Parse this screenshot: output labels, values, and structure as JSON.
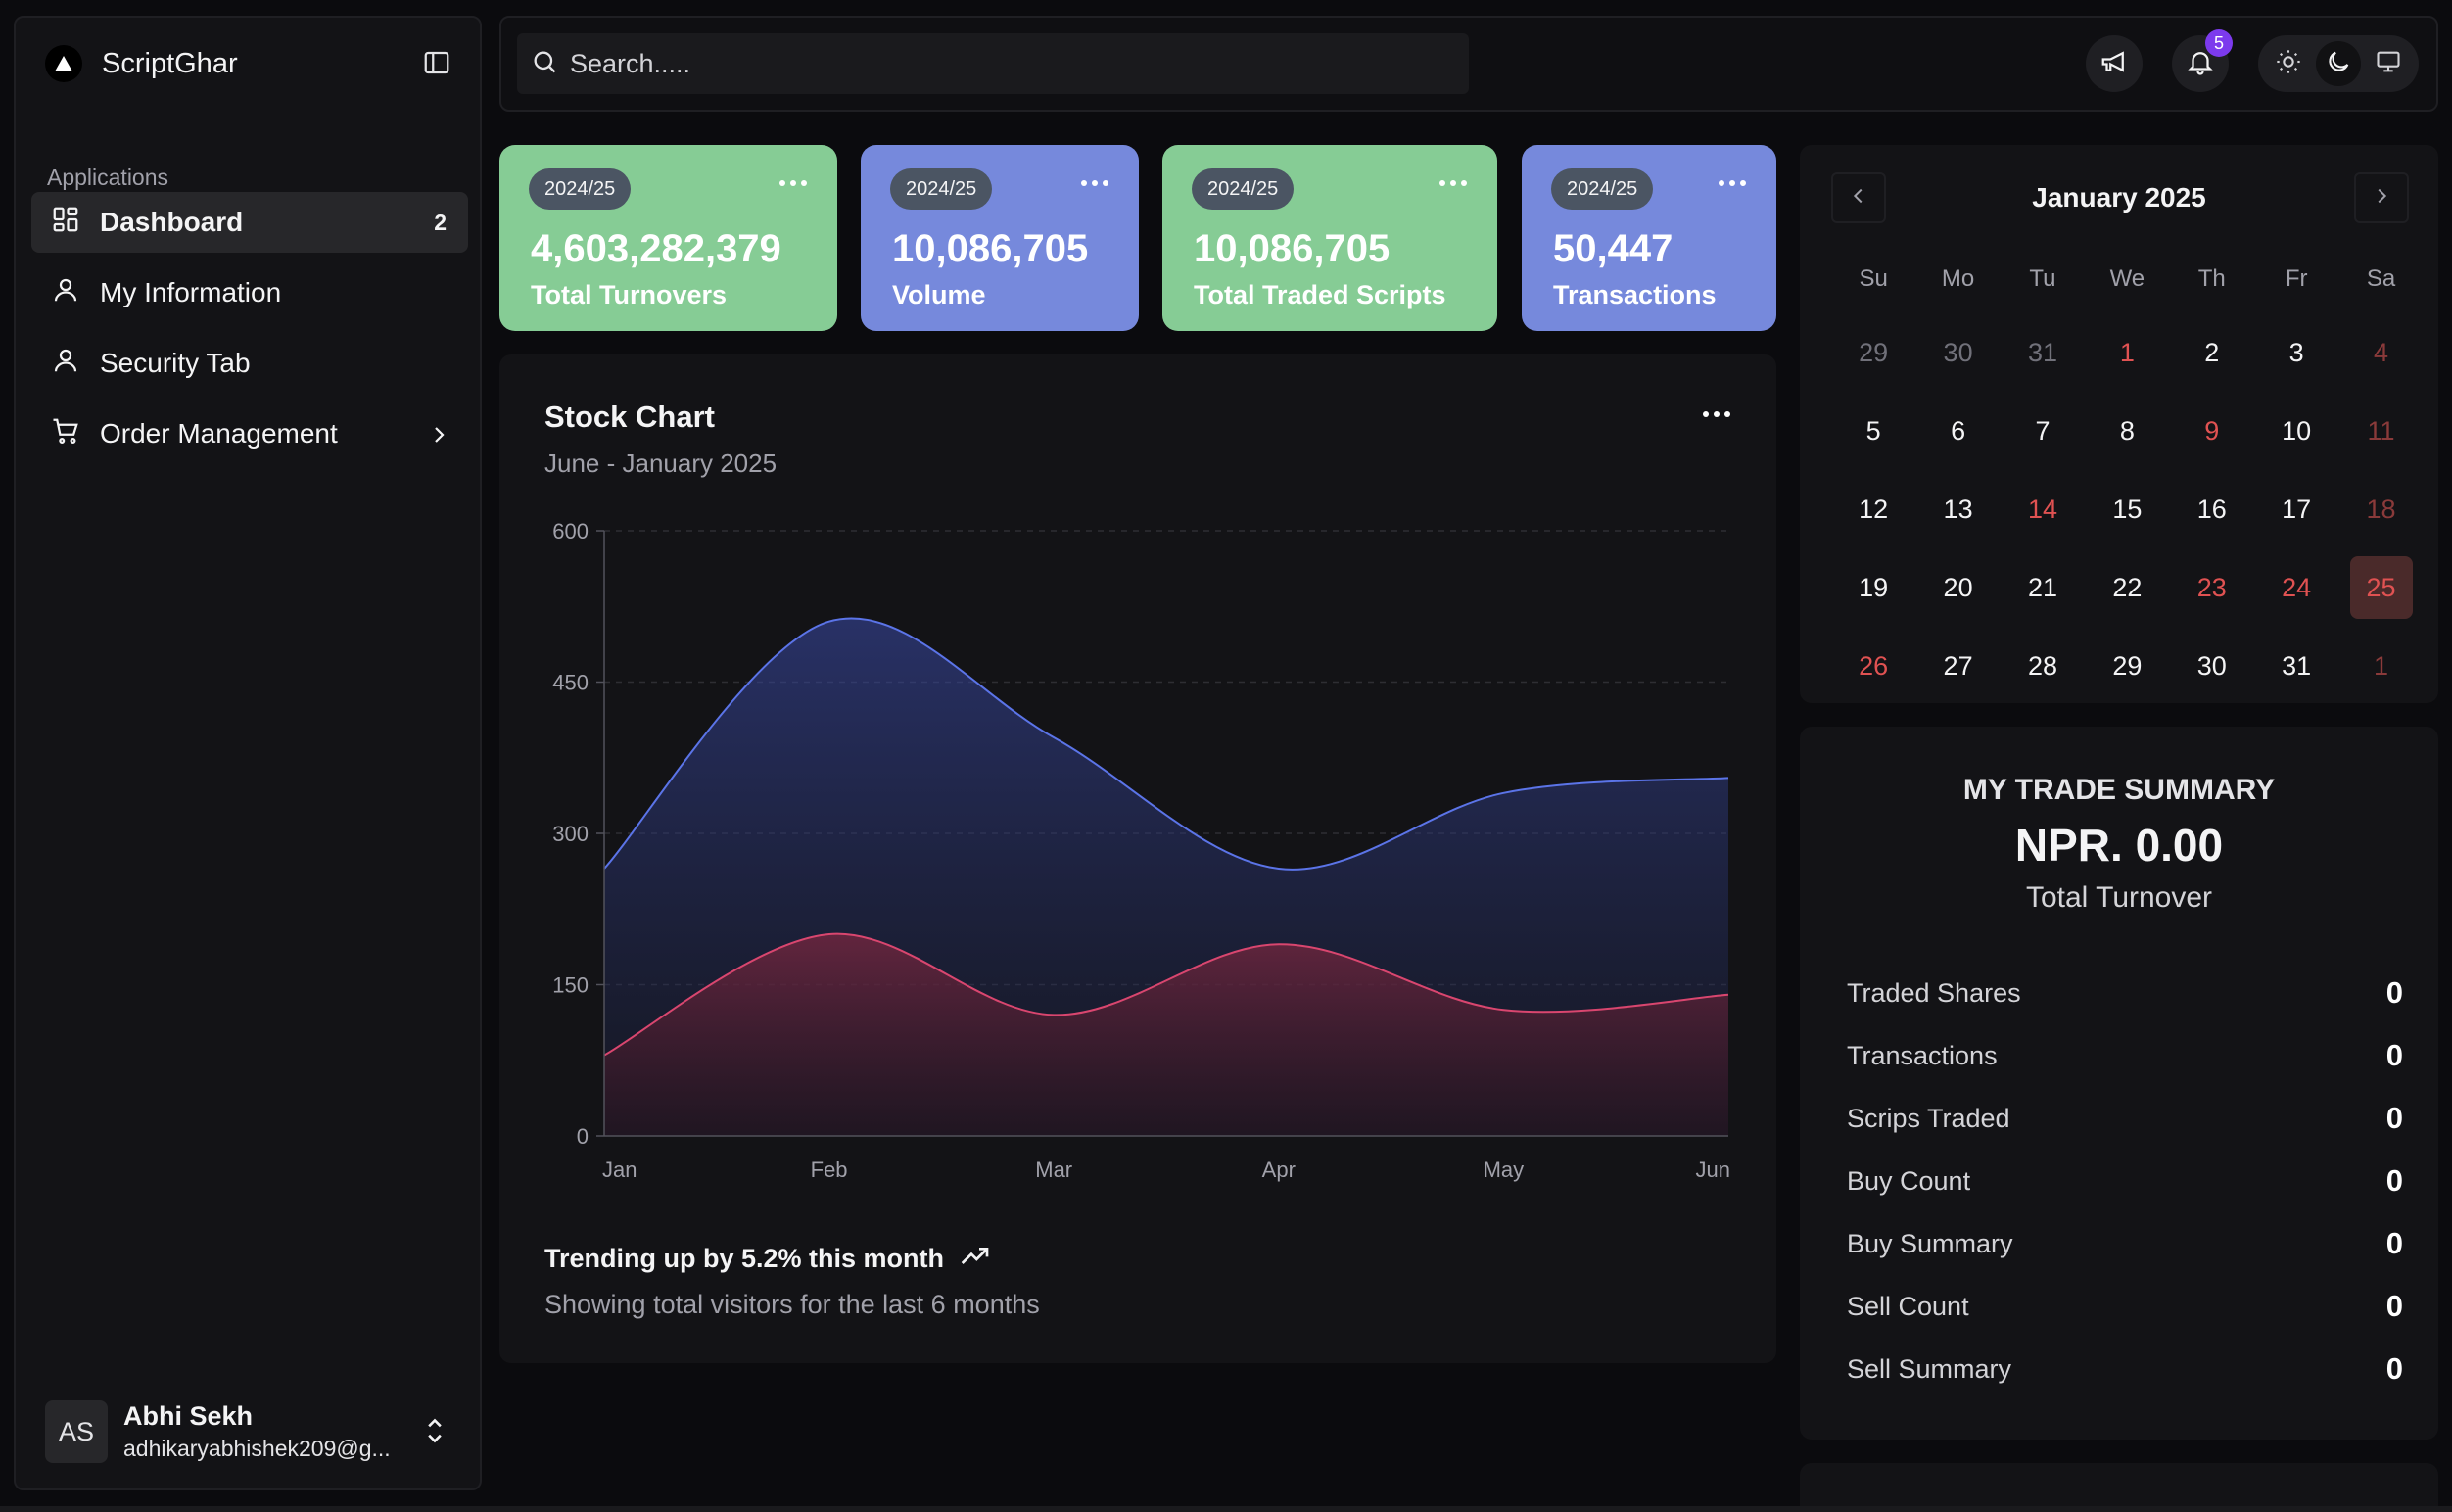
{
  "app": {
    "name": "ScriptGhar"
  },
  "sidebar": {
    "section_label": "Applications",
    "items": [
      {
        "label": "Dashboard",
        "count": "2",
        "icon": "layout-grid-icon",
        "active": true
      },
      {
        "label": "My Information",
        "icon": "user-icon"
      },
      {
        "label": "Security Tab",
        "icon": "user-icon"
      },
      {
        "label": "Order Management",
        "icon": "cart-icon",
        "has_submenu": true
      }
    ],
    "user": {
      "initials": "AS",
      "name": "Abhi Sekh",
      "email": "adhikaryabhishek209@g..."
    }
  },
  "topbar": {
    "search_placeholder": "Search.....",
    "notification_count": "5",
    "icons": [
      "megaphone-icon",
      "bell-icon",
      "sun-icon",
      "moon-icon",
      "monitor-icon"
    ]
  },
  "stats": [
    {
      "chip": "2024/25",
      "value": "4,603,282,379",
      "label": "Total Turnovers",
      "color": "#86cc95"
    },
    {
      "chip": "2024/25",
      "value": "10,086,705",
      "label": "Volume",
      "color": "#7689dc"
    },
    {
      "chip": "2024/25",
      "value": "10,086,705",
      "label": "Total Traded Scripts",
      "color": "#86cc95"
    },
    {
      "chip": "2024/25",
      "value": "50,447",
      "label": "Transactions",
      "color": "#7689dc"
    }
  ],
  "chart": {
    "title": "Stock Chart",
    "subtitle": "June - January 2025",
    "trend_text": "Trending up by 5.2% this month",
    "trend_sub": "Showing total visitors for the last 6 months"
  },
  "chart_data": {
    "type": "area",
    "categories": [
      "Jan",
      "Feb",
      "Mar",
      "Apr",
      "May",
      "Jun"
    ],
    "series": [
      {
        "values": [
          265,
          510,
          395,
          265,
          340,
          355
        ],
        "color": "#5b74e8"
      },
      {
        "values": [
          80,
          200,
          120,
          190,
          125,
          140
        ],
        "color": "#d9466f"
      }
    ],
    "ylim": [
      0,
      600
    ],
    "yticks": [
      0,
      150,
      300,
      450,
      600
    ],
    "grid": true
  },
  "calendar": {
    "title": "January 2025",
    "weekdays": [
      "Su",
      "Mo",
      "Tu",
      "We",
      "Th",
      "Fr",
      "Sa"
    ],
    "days": [
      {
        "d": "29",
        "o": true
      },
      {
        "d": "30",
        "o": true
      },
      {
        "d": "31",
        "o": true
      },
      {
        "d": "1",
        "h": true
      },
      {
        "d": "2"
      },
      {
        "d": "3"
      },
      {
        "d": "4",
        "o": true,
        "h": true
      },
      {
        "d": "5"
      },
      {
        "d": "6"
      },
      {
        "d": "7"
      },
      {
        "d": "8"
      },
      {
        "d": "9",
        "h": true
      },
      {
        "d": "10"
      },
      {
        "d": "11",
        "o": true,
        "h": true
      },
      {
        "d": "12"
      },
      {
        "d": "13"
      },
      {
        "d": "14",
        "h": true
      },
      {
        "d": "15"
      },
      {
        "d": "16"
      },
      {
        "d": "17"
      },
      {
        "d": "18",
        "o": true,
        "h": true
      },
      {
        "d": "19"
      },
      {
        "d": "20"
      },
      {
        "d": "21"
      },
      {
        "d": "22"
      },
      {
        "d": "23",
        "h": true
      },
      {
        "d": "24",
        "h": true
      },
      {
        "d": "25",
        "t": true
      },
      {
        "d": "26",
        "h": true
      },
      {
        "d": "27"
      },
      {
        "d": "28"
      },
      {
        "d": "29"
      },
      {
        "d": "30"
      },
      {
        "d": "31"
      },
      {
        "d": "1",
        "o": true,
        "h": true
      }
    ]
  },
  "summary": {
    "title": "MY TRADE SUMMARY",
    "amount": "NPR. 0.00",
    "label": "Total Turnover",
    "rows": [
      {
        "label": "Traded Shares",
        "value": "0"
      },
      {
        "label": "Transactions",
        "value": "0"
      },
      {
        "label": "Scrips Traded",
        "value": "0"
      },
      {
        "label": "Buy Count",
        "value": "0"
      },
      {
        "label": "Buy Summary",
        "value": "0"
      },
      {
        "label": "Sell Count",
        "value": "0"
      },
      {
        "label": "Sell Summary",
        "value": "0"
      }
    ]
  }
}
